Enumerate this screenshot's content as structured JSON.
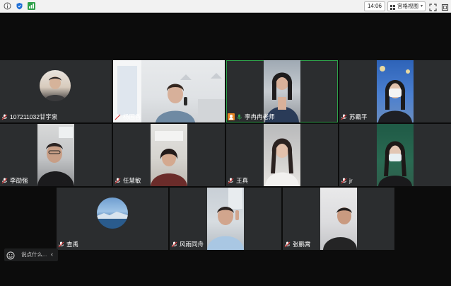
{
  "topbar": {
    "time": "14:06",
    "view_label": "宫格视图",
    "view_caret": "▾"
  },
  "participants": [
    {
      "name": "107211032甘宇泉"
    },
    {
      "name": "杨国香"
    },
    {
      "name": "李冉冉老师"
    },
    {
      "name": "苏霸平"
    },
    {
      "name": "李劭强"
    },
    {
      "name": "任慧敏"
    },
    {
      "name": "王真"
    },
    {
      "name": "jr"
    },
    {
      "name": "查禹"
    },
    {
      "name": "风雨同舟"
    },
    {
      "name": "张鹏霄"
    }
  ],
  "chat": {
    "placeholder": "说点什么...",
    "collapse_glyph": "‹"
  },
  "colors": {
    "tile_bg": "#2b2d2f",
    "active_border": "#2ea04a",
    "host_badge": "#e78522",
    "mic_active": "#2ea04a"
  }
}
